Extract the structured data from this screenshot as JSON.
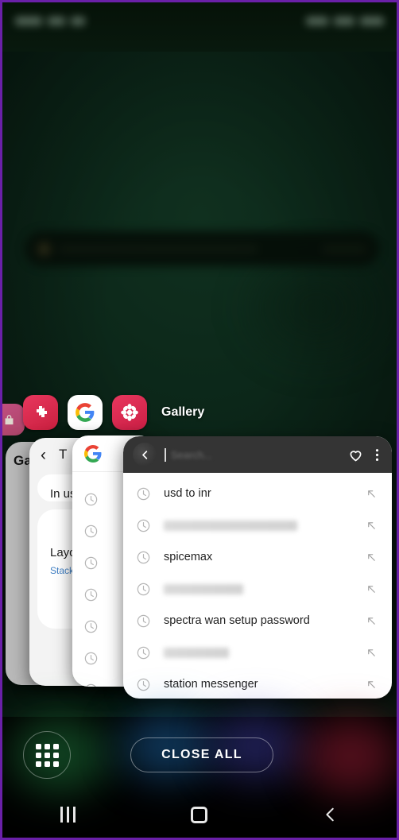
{
  "screen": {
    "accent_purple": "#6a20a8",
    "wallpaper_color": "#0c2819",
    "card_dark_header": "#343434"
  },
  "statusbar": {
    "visible": true
  },
  "wallpaper_widget": {
    "search_blurred": true
  },
  "app_icon_row": {
    "icons": [
      {
        "name": "samsung-store-icon",
        "glyph": "puzzle",
        "color": "#e8375e"
      },
      {
        "name": "google-icon",
        "glyph": "G",
        "color": "#ffffff"
      },
      {
        "name": "gallery-icon",
        "glyph": "flower",
        "color": "#e8375e"
      }
    ],
    "active_label": "Gallery"
  },
  "recents": {
    "cards": [
      {
        "id": "gallery",
        "title": "Galc"
      },
      {
        "id": "settings",
        "back_icon": "chevron-left-icon",
        "title": "T",
        "section_label": "In use",
        "option_label": "Layou",
        "option_value": "Stack"
      },
      {
        "id": "google",
        "logo": "google-g-icon",
        "row_count": 7
      },
      {
        "id": "browser",
        "back_icon": "chevron-left-icon",
        "search_placeholder": "Search...",
        "favorite_icon": "heart-icon",
        "menu_icon": "more-vertical-icon",
        "suggestions": [
          {
            "icon": "history-clock-icon",
            "text": "usd to inr",
            "redacted": false,
            "action_icon": "arrow-up-left-icon"
          },
          {
            "icon": "history-clock-icon",
            "text": "",
            "redacted": true,
            "redact_width": 168,
            "action_icon": "arrow-up-left-icon"
          },
          {
            "icon": "history-clock-icon",
            "text": "spicemax",
            "redacted": false,
            "action_icon": "arrow-up-left-icon"
          },
          {
            "icon": "history-clock-icon",
            "text": "",
            "redacted": true,
            "redact_width": 100,
            "action_icon": "arrow-up-left-icon"
          },
          {
            "icon": "history-clock-icon",
            "text": "spectra wan setup password",
            "redacted": false,
            "action_icon": "arrow-up-left-icon"
          },
          {
            "icon": "history-clock-icon",
            "text": "",
            "redacted": true,
            "redact_width": 82,
            "action_icon": "arrow-up-left-icon"
          },
          {
            "icon": "history-clock-icon",
            "text": "station messenger",
            "redacted": false,
            "action_icon": "arrow-up-left-icon"
          }
        ]
      }
    ]
  },
  "bottom_bar": {
    "apps_button": "apps-grid-icon",
    "close_all_label": "CLOSE ALL"
  },
  "navbar": {
    "recents": "recents-icon",
    "home": "home-icon",
    "back": "back-icon"
  }
}
